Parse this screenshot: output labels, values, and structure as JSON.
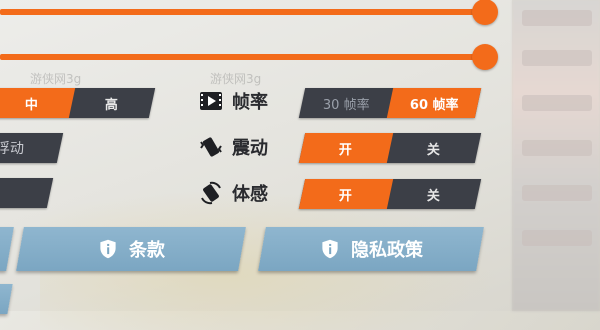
{
  "sliders": [
    {
      "name": "slider-1",
      "value": 1.0
    },
    {
      "name": "slider-2",
      "value": 1.0
    }
  ],
  "quality": {
    "options": [
      "中",
      "高"
    ],
    "selected": "中"
  },
  "float_button": {
    "label": "浮动"
  },
  "frame_rate": {
    "label": "帧率",
    "options": [
      "30 帧率",
      "60 帧率"
    ],
    "selected": "60 帧率"
  },
  "vibration": {
    "label": "震动",
    "options": [
      "开",
      "关"
    ],
    "selected": "开"
  },
  "motion": {
    "label": "体感",
    "options": [
      "开",
      "关"
    ],
    "selected": "开"
  },
  "buttons": {
    "terms": "条款",
    "privacy": "隐私政策"
  },
  "watermarks": [
    "游侠网3g",
    "游侠网3g"
  ],
  "colors": {
    "accent": "#f36b1a",
    "dark": "#3c3f47",
    "blue": "#7ba6c2"
  },
  "icons": {
    "frame_rate": "film-play-icon",
    "vibration": "phone-vibrate-icon",
    "motion": "phone-rotate-icon",
    "info": "shield-info-icon"
  }
}
